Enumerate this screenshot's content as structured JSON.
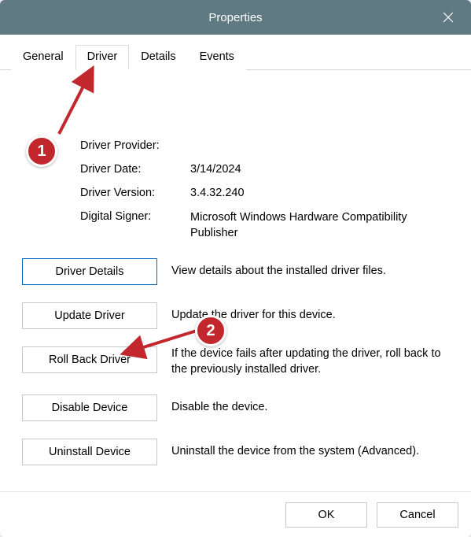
{
  "window": {
    "title": "Properties"
  },
  "tabs": {
    "general": "General",
    "driver": "Driver",
    "details": "Details",
    "events": "Events"
  },
  "info": {
    "provider_label": "Driver Provider:",
    "provider_value": "",
    "date_label": "Driver Date:",
    "date_value": "3/14/2024",
    "version_label": "Driver Version:",
    "version_value": "3.4.32.240",
    "signer_label": "Digital Signer:",
    "signer_value": "Microsoft Windows Hardware Compatibility Publisher"
  },
  "actions": {
    "details_btn": "Driver Details",
    "details_desc": "View details about the installed driver files.",
    "update_btn": "Update Driver",
    "update_desc": "Update the driver for this device.",
    "rollback_btn": "Roll Back Driver",
    "rollback_desc": "If the device fails after updating the driver, roll back to the previously installed driver.",
    "disable_btn": "Disable Device",
    "disable_desc": "Disable the device.",
    "uninstall_btn": "Uninstall Device",
    "uninstall_desc": "Uninstall the device from the system (Advanced)."
  },
  "footer": {
    "ok": "OK",
    "cancel": "Cancel"
  },
  "annotations": {
    "marker1": "1",
    "marker2": "2"
  },
  "colors": {
    "titlebar": "#5f7a83",
    "accent": "#0067c0",
    "annotation": "#c1272d"
  }
}
